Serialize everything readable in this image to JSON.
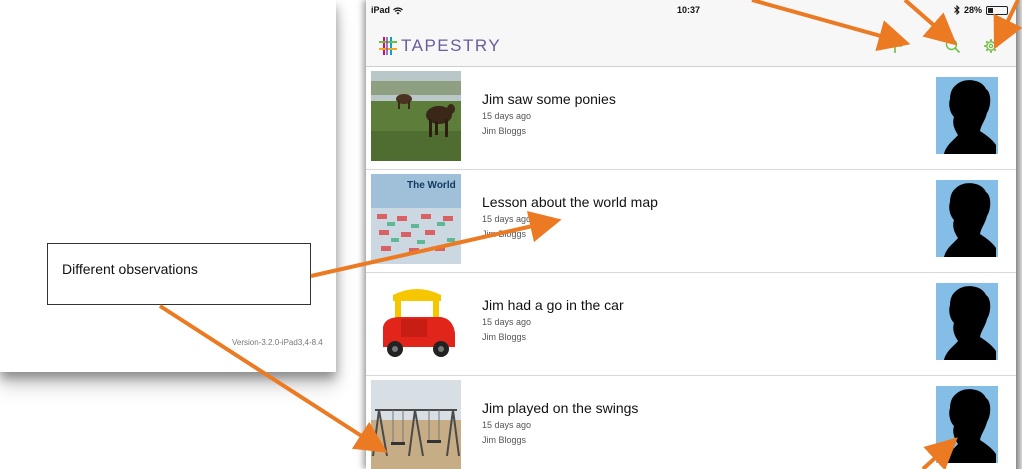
{
  "background_screen": {
    "version_label": "Version-3.2.0-iPad3,4-8.4"
  },
  "status_bar": {
    "carrier": "iPad",
    "wifi_icon": "wifi-icon",
    "time": "10:37",
    "bluetooth_icon": "bluetooth-icon",
    "battery": "28%",
    "battery_level": 0.28
  },
  "nav_bar": {
    "logo_text": "TAPESTRY",
    "logo_color": "#6a5d9c",
    "accent_color": "#6dbf3e",
    "add_icon": "plus-icon",
    "search_icon": "search-icon",
    "settings_icon": "gear-icon"
  },
  "observations": [
    {
      "title": "Jim saw some ponies",
      "time": "15 days ago",
      "author": "Jim Bloggs",
      "thumb": "ponies-photo"
    },
    {
      "title": "Lesson about the world map",
      "time": "15 days ago",
      "author": "Jim Bloggs",
      "thumb": "world-map-photo",
      "thumb_text": "The World"
    },
    {
      "title": "Jim had a go in the car",
      "time": "15 days ago",
      "author": "Jim Bloggs",
      "thumb": "toy-car-photo"
    },
    {
      "title": "Jim played on the swings",
      "time": "15 days ago",
      "author": "Jim Bloggs",
      "thumb": "swings-photo"
    }
  ],
  "callout": {
    "text": "Different observations",
    "arrow_color": "#ec7a23"
  }
}
